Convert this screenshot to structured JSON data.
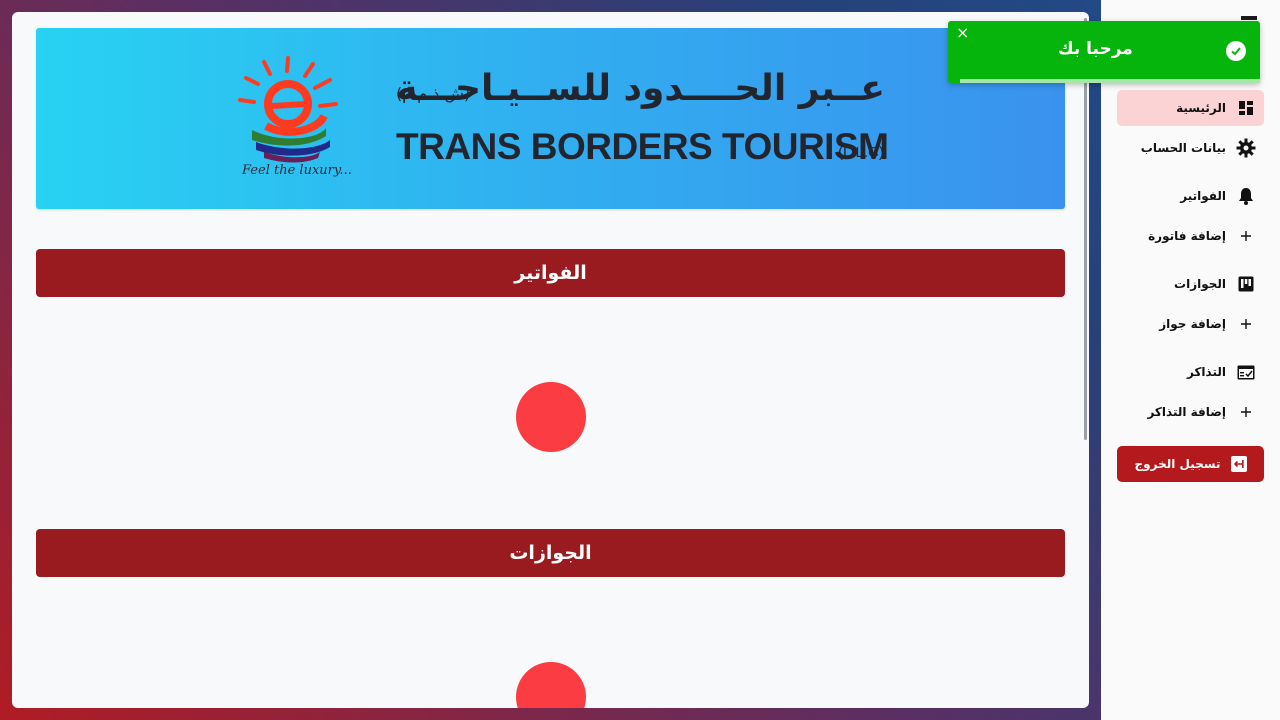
{
  "banner": {
    "brand_ar": "عــبر الحــــدود للســيـاحـــة",
    "brand_ar_sub": "(ش.ذ.م.م)",
    "brand_en": "TRANS BORDERS TOURISM",
    "brand_en_sub": "(L.L.C)",
    "slogan": "Feel the luxury..."
  },
  "sections": [
    {
      "title": "الفواتير"
    },
    {
      "title": "الجوازات"
    }
  ],
  "sidebar": {
    "items": [
      {
        "label": "الرئيسية",
        "icon": "dashboard-icon"
      },
      {
        "label": "بيانات الحساب",
        "icon": "gear-icon"
      },
      {
        "label": "الفواتير",
        "icon": "bell-icon"
      },
      {
        "label": "إضافة فاتورة",
        "icon": "plus-icon"
      },
      {
        "label": "الجوازات",
        "icon": "board-icon"
      },
      {
        "label": "إضافة جواز",
        "icon": "plus-icon"
      },
      {
        "label": "التذاكر",
        "icon": "calendar-check-icon"
      },
      {
        "label": "إضافة التذاكر",
        "icon": "plus-icon"
      }
    ],
    "logout_label": "تسجيل الخروج"
  },
  "toast": {
    "message": "مرحبا بك",
    "close_glyph": "×"
  },
  "colors": {
    "section_bar": "#9a1b1f",
    "loader": "#fb3d43",
    "toast": "#06b50c",
    "active_item": "#fbd3d4",
    "logout": "#b3191d"
  }
}
